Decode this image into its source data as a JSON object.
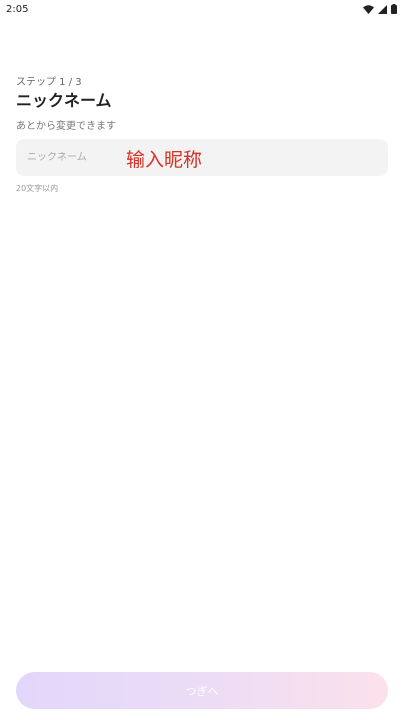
{
  "status_bar": {
    "time": "2:05",
    "icons": [
      "wifi-icon",
      "signal-icon",
      "battery-icon"
    ]
  },
  "header": {
    "step": "ステップ 1 / 3",
    "title": "ニックネーム",
    "subtitle": "あとから変更できます"
  },
  "nickname": {
    "placeholder": "ニックネーム",
    "value": "",
    "annotation": "输入昵称",
    "helper": "20文字以内"
  },
  "footer": {
    "next_label": "つぎへ",
    "enabled": false
  },
  "colors": {
    "annotation": "#d93025",
    "field_bg": "#f3f3f3",
    "button_gradient": [
      "#e2d6fb",
      "#fbe1ea"
    ]
  }
}
